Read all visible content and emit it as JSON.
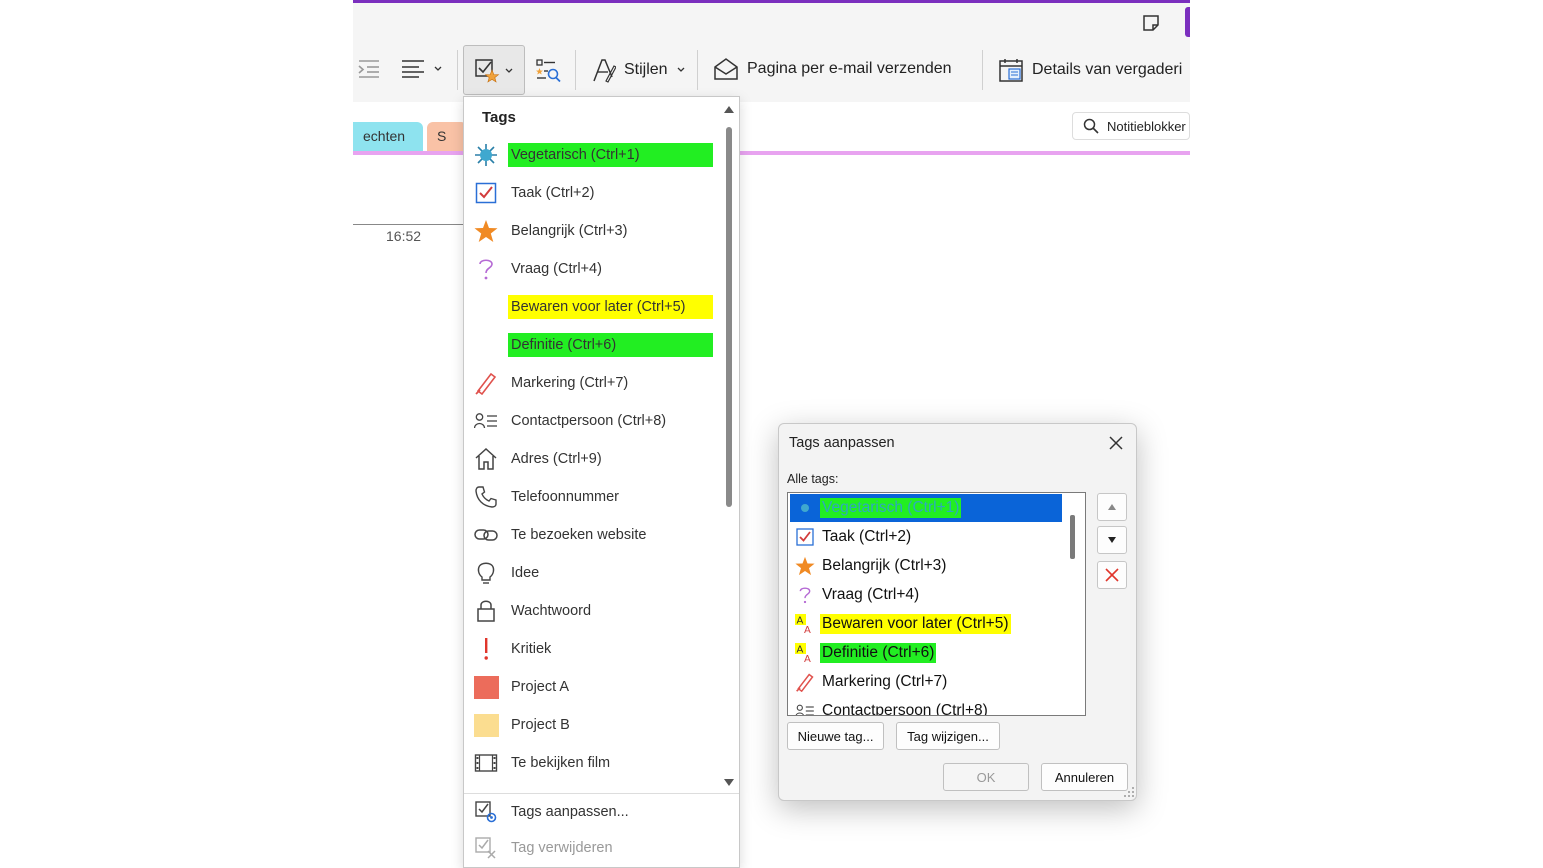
{
  "ribbon": {
    "styles_label": "Stijlen",
    "email_label": "Pagina per e-mail verzenden",
    "meeting_label": "Details van vergaderi"
  },
  "sections": [
    {
      "label": "echten",
      "color": "#8ee3ef"
    },
    {
      "label": "S",
      "color": "#f9c2a6"
    }
  ],
  "search": {
    "label": "Notitieblokker"
  },
  "page": {
    "time": "16:52"
  },
  "tags_menu": {
    "title": "Tags",
    "items": [
      {
        "label": "Vegetarisch (Ctrl+1)",
        "icon": "sun-burst-icon",
        "highlight": "green"
      },
      {
        "label": "Taak (Ctrl+2)",
        "icon": "checkbox-checked-icon"
      },
      {
        "label": "Belangrijk (Ctrl+3)",
        "icon": "star-icon"
      },
      {
        "label": "Vraag (Ctrl+4)",
        "icon": "question-mark-icon"
      },
      {
        "label": "Bewaren voor later (Ctrl+5)",
        "icon": "",
        "highlight": "yellow"
      },
      {
        "label": "Definitie (Ctrl+6)",
        "icon": "",
        "highlight": "green"
      },
      {
        "label": "Markering (Ctrl+7)",
        "icon": "highlighter-pen-icon"
      },
      {
        "label": "Contactpersoon (Ctrl+8)",
        "icon": "contact-card-icon"
      },
      {
        "label": "Adres (Ctrl+9)",
        "icon": "house-icon"
      },
      {
        "label": "Telefoonnummer",
        "icon": "phone-icon"
      },
      {
        "label": "Te bezoeken website",
        "icon": "link-icon"
      },
      {
        "label": "Idee",
        "icon": "lightbulb-icon"
      },
      {
        "label": "Wachtwoord",
        "icon": "padlock-icon"
      },
      {
        "label": "Kritiek",
        "icon": "exclamation-icon"
      },
      {
        "label": "Project A",
        "icon": "red-square-icon"
      },
      {
        "label": "Project B",
        "icon": "yellow-square-icon"
      },
      {
        "label": "Te bekijken film",
        "icon": "film-strip-icon"
      }
    ],
    "customize_label": "Tags aanpassen...",
    "remove_label": "Tag verwijderen"
  },
  "dialog": {
    "title": "Tags aanpassen",
    "all_tags_label": "Alle tags:",
    "items": [
      {
        "label": "Vegetarisch (Ctrl+1)",
        "icon": "sun-burst-icon",
        "highlight": "green",
        "selected": true
      },
      {
        "label": "Taak (Ctrl+2)",
        "icon": "checkbox-checked-icon"
      },
      {
        "label": "Belangrijk (Ctrl+3)",
        "icon": "star-icon"
      },
      {
        "label": "Vraag (Ctrl+4)",
        "icon": "question-mark-icon"
      },
      {
        "label": "Bewaren voor later (Ctrl+5)",
        "icon": "highlight-text-icon",
        "highlight": "yellow"
      },
      {
        "label": "Definitie (Ctrl+6)",
        "icon": "highlight-text-icon",
        "highlight": "green"
      },
      {
        "label": "Markering (Ctrl+7)",
        "icon": "highlighter-pen-icon"
      },
      {
        "label": "Contactpersoon (Ctrl+8)",
        "icon": "contact-card-icon"
      }
    ],
    "new_tag_label": "Nieuwe tag...",
    "edit_tag_label": "Tag wijzigen...",
    "ok_label": "OK",
    "cancel_label": "Annuleren"
  },
  "colors": {
    "accent_purple": "#7b2fbe",
    "highlight_green": "#22ee22",
    "highlight_yellow": "#ffff00",
    "selection_blue": "#0a64d8"
  }
}
